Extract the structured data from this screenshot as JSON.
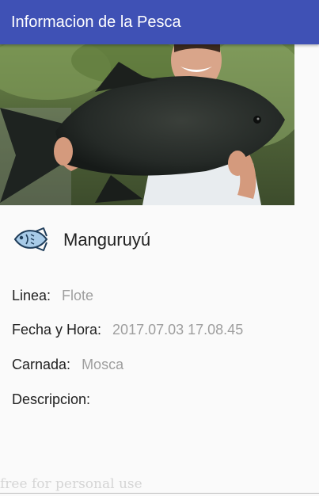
{
  "app_bar": {
    "title": "Informacion de la Pesca"
  },
  "photo": {
    "subject": "person holding large fish"
  },
  "fish": {
    "icon": "fish-icon",
    "name": "Manguruyú"
  },
  "details": {
    "linea_label": "Linea:",
    "linea_value": "Flote",
    "fecha_label": "Fecha y Hora:",
    "fecha_value": "2017.07.03 17.08.45",
    "carnada_label": "Carnada:",
    "carnada_value": "Mosca",
    "descripcion_label": "Descripcion:",
    "descripcion_value": ""
  },
  "watermark": {
    "text": "free for personal use"
  },
  "colors": {
    "app_bar": "#3f51b5",
    "label_text": "#212121",
    "value_text": "#9e9e9e",
    "fish_icon_fill": "#a8cbe8",
    "fish_icon_stroke": "#1f3d5a"
  }
}
